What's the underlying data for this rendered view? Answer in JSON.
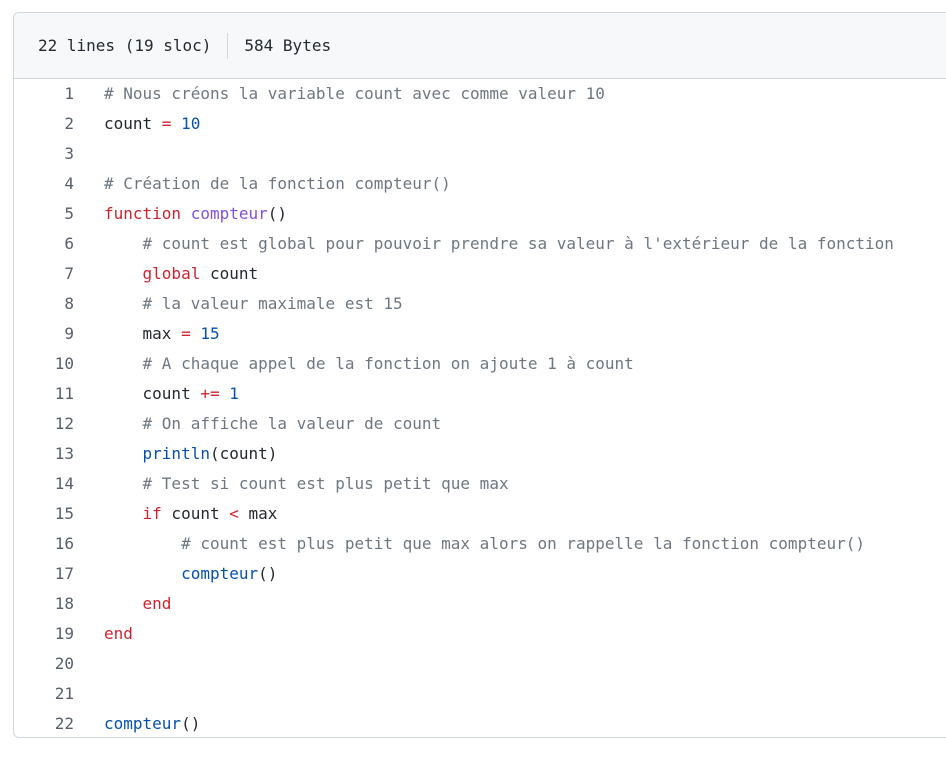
{
  "file_header": {
    "lines_info": "22 lines (19 sloc)",
    "size_info": "584 Bytes"
  },
  "colors": {
    "comment": "#6e7781",
    "keyword": "#cf222e",
    "number": "#0550ae",
    "function_def": "#8250df",
    "call": "#0550ae",
    "line_number": "#57606a",
    "border": "#d0d7de",
    "header_bg": "#f6f8fa"
  },
  "code_lines": [
    {
      "num": "1",
      "tokens": [
        {
          "t": "# Nous créons la variable count avec comme valeur 10",
          "k": "comment"
        }
      ]
    },
    {
      "num": "2",
      "tokens": [
        {
          "t": "count ",
          "k": "plain"
        },
        {
          "t": "=",
          "k": "op"
        },
        {
          "t": " ",
          "k": "plain"
        },
        {
          "t": "10",
          "k": "number"
        }
      ]
    },
    {
      "num": "3",
      "tokens": []
    },
    {
      "num": "4",
      "tokens": [
        {
          "t": "# Création de la fonction compteur()",
          "k": "comment"
        }
      ]
    },
    {
      "num": "5",
      "tokens": [
        {
          "t": "function",
          "k": "keyword"
        },
        {
          "t": " ",
          "k": "plain"
        },
        {
          "t": "compteur",
          "k": "funcdef"
        },
        {
          "t": "()",
          "k": "plain"
        }
      ]
    },
    {
      "num": "6",
      "tokens": [
        {
          "t": "    ",
          "k": "plain"
        },
        {
          "t": "# count est global pour pouvoir prendre sa valeur à l'extérieur de la fonction",
          "k": "comment"
        }
      ]
    },
    {
      "num": "7",
      "tokens": [
        {
          "t": "    ",
          "k": "plain"
        },
        {
          "t": "global",
          "k": "keyword"
        },
        {
          "t": " count",
          "k": "plain"
        }
      ]
    },
    {
      "num": "8",
      "tokens": [
        {
          "t": "    ",
          "k": "plain"
        },
        {
          "t": "# la valeur maximale est 15",
          "k": "comment"
        }
      ]
    },
    {
      "num": "9",
      "tokens": [
        {
          "t": "    max ",
          "k": "plain"
        },
        {
          "t": "=",
          "k": "op"
        },
        {
          "t": " ",
          "k": "plain"
        },
        {
          "t": "15",
          "k": "number"
        }
      ]
    },
    {
      "num": "10",
      "tokens": [
        {
          "t": "    ",
          "k": "plain"
        },
        {
          "t": "# A chaque appel de la fonction on ajoute 1 à count",
          "k": "comment"
        }
      ]
    },
    {
      "num": "11",
      "tokens": [
        {
          "t": "    count ",
          "k": "plain"
        },
        {
          "t": "+=",
          "k": "op"
        },
        {
          "t": " ",
          "k": "plain"
        },
        {
          "t": "1",
          "k": "number"
        }
      ]
    },
    {
      "num": "12",
      "tokens": [
        {
          "t": "    ",
          "k": "plain"
        },
        {
          "t": "# On affiche la valeur de count",
          "k": "comment"
        }
      ]
    },
    {
      "num": "13",
      "tokens": [
        {
          "t": "    ",
          "k": "plain"
        },
        {
          "t": "println",
          "k": "call"
        },
        {
          "t": "(count)",
          "k": "plain"
        }
      ]
    },
    {
      "num": "14",
      "tokens": [
        {
          "t": "    ",
          "k": "plain"
        },
        {
          "t": "# Test si count est plus petit que max",
          "k": "comment"
        }
      ]
    },
    {
      "num": "15",
      "tokens": [
        {
          "t": "    ",
          "k": "plain"
        },
        {
          "t": "if",
          "k": "keyword"
        },
        {
          "t": " count ",
          "k": "plain"
        },
        {
          "t": "<",
          "k": "op"
        },
        {
          "t": " max",
          "k": "plain"
        }
      ]
    },
    {
      "num": "16",
      "tokens": [
        {
          "t": "        ",
          "k": "plain"
        },
        {
          "t": "# count est plus petit que max alors on rappelle la fonction compteur()",
          "k": "comment"
        }
      ]
    },
    {
      "num": "17",
      "tokens": [
        {
          "t": "        ",
          "k": "plain"
        },
        {
          "t": "compteur",
          "k": "call"
        },
        {
          "t": "()",
          "k": "plain"
        }
      ]
    },
    {
      "num": "18",
      "tokens": [
        {
          "t": "    ",
          "k": "plain"
        },
        {
          "t": "end",
          "k": "keyword"
        }
      ]
    },
    {
      "num": "19",
      "tokens": [
        {
          "t": "end",
          "k": "keyword"
        }
      ]
    },
    {
      "num": "20",
      "tokens": []
    },
    {
      "num": "21",
      "tokens": []
    },
    {
      "num": "22",
      "tokens": [
        {
          "t": "compteur",
          "k": "call"
        },
        {
          "t": "()",
          "k": "plain"
        }
      ]
    }
  ]
}
